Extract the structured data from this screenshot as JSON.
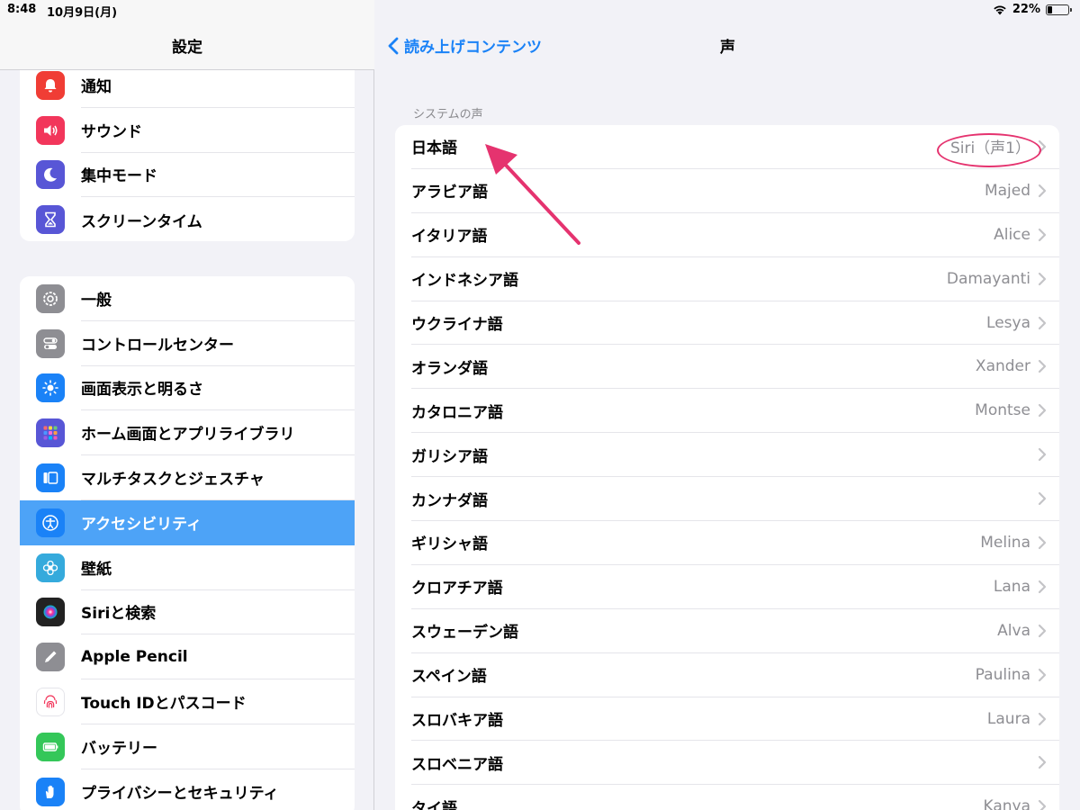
{
  "status": {
    "time": "8:48",
    "date": "10月9日(月)",
    "battery": "22%",
    "battery_level": 0.22
  },
  "sidebar": {
    "title": "設定",
    "group1": [
      {
        "label": "通知",
        "icon": "notification-bell-icon",
        "color": "#f03d35"
      },
      {
        "label": "サウンド",
        "icon": "speaker-icon",
        "color": "#f2365b"
      },
      {
        "label": "集中モード",
        "icon": "moon-icon",
        "color": "#5856d6"
      },
      {
        "label": "スクリーンタイム",
        "icon": "hourglass-icon",
        "color": "#5856d6"
      }
    ],
    "group2": [
      {
        "label": "一般",
        "icon": "gear-icon",
        "color": "#8e8e93"
      },
      {
        "label": "コントロールセンター",
        "icon": "toggle-switches-icon",
        "color": "#8e8e93"
      },
      {
        "label": "画面表示と明るさ",
        "icon": "sun-icon",
        "color": "#1a82f7"
      },
      {
        "label": "ホーム画面とアプリライブラリ",
        "icon": "app-grid-icon",
        "color": "#5856d6"
      },
      {
        "label": "マルチタスクとジェスチャ",
        "icon": "multitask-icon",
        "color": "#1a82f7"
      },
      {
        "label": "アクセシビリティ",
        "icon": "accessibility-icon",
        "color": "#1a82f7",
        "active": true
      },
      {
        "label": "壁紙",
        "icon": "flower-icon",
        "color": "#35aadc"
      },
      {
        "label": "Siriと検索",
        "icon": "siri-icon",
        "color": "#222222"
      },
      {
        "label": "Apple Pencil",
        "icon": "pencil-icon",
        "color": "#8e8e93"
      },
      {
        "label": "Touch IDとパスコード",
        "icon": "fingerprint-icon",
        "color": "#ffffff"
      },
      {
        "label": "バッテリー",
        "icon": "battery-icon",
        "color": "#34c759"
      },
      {
        "label": "プライバシーとセキュリティ",
        "icon": "hand-icon",
        "color": "#1a82f7"
      }
    ]
  },
  "main": {
    "back_label": "読み上げコンテンツ",
    "title": "声",
    "section_header": "システムの声",
    "voices": [
      {
        "lang": "日本語",
        "voice": "Siri（声1）"
      },
      {
        "lang": "アラビア語",
        "voice": "Majed"
      },
      {
        "lang": "イタリア語",
        "voice": "Alice"
      },
      {
        "lang": "インドネシア語",
        "voice": "Damayanti"
      },
      {
        "lang": "ウクライナ語",
        "voice": "Lesya"
      },
      {
        "lang": "オランダ語",
        "voice": "Xander"
      },
      {
        "lang": "カタロニア語",
        "voice": "Montse"
      },
      {
        "lang": "ガリシア語",
        "voice": ""
      },
      {
        "lang": "カンナダ語",
        "voice": ""
      },
      {
        "lang": "ギリシャ語",
        "voice": "Melina"
      },
      {
        "lang": "クロアチア語",
        "voice": "Lana"
      },
      {
        "lang": "スウェーデン語",
        "voice": "Alva"
      },
      {
        "lang": "スペイン語",
        "voice": "Paulina"
      },
      {
        "lang": "スロバキア語",
        "voice": "Laura"
      },
      {
        "lang": "スロベニア語",
        "voice": ""
      },
      {
        "lang": "タイ語",
        "voice": "Kanya"
      }
    ]
  },
  "annotations": {
    "color": "#e5336f"
  }
}
